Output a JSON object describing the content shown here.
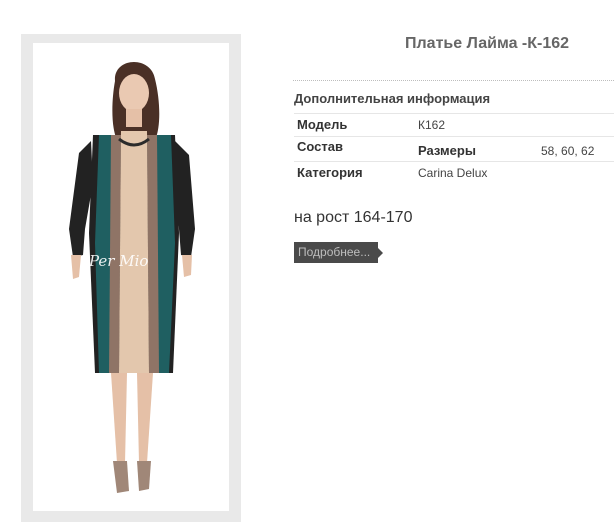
{
  "product": {
    "title": "Платье Лайма -К-162",
    "height_note": "на рост 164-170",
    "more_button_label": "Подробнее..."
  },
  "photo": {
    "watermark": "Per Mio"
  },
  "info": {
    "heading": "Дополнительная информация",
    "rows": [
      {
        "label": "Модель",
        "value": "К162"
      },
      {
        "label": "Состав",
        "sublabel": "Размеры",
        "value": "58, 60, 62"
      },
      {
        "label": "Категория",
        "value": "Carina Delux"
      }
    ]
  },
  "colors": {
    "dress_beige": "#e3c7ad",
    "dress_taupe": "#8f7466",
    "dress_teal": "#1f5f61",
    "dress_black": "#222222",
    "button_bg": "#4a4a4a"
  }
}
